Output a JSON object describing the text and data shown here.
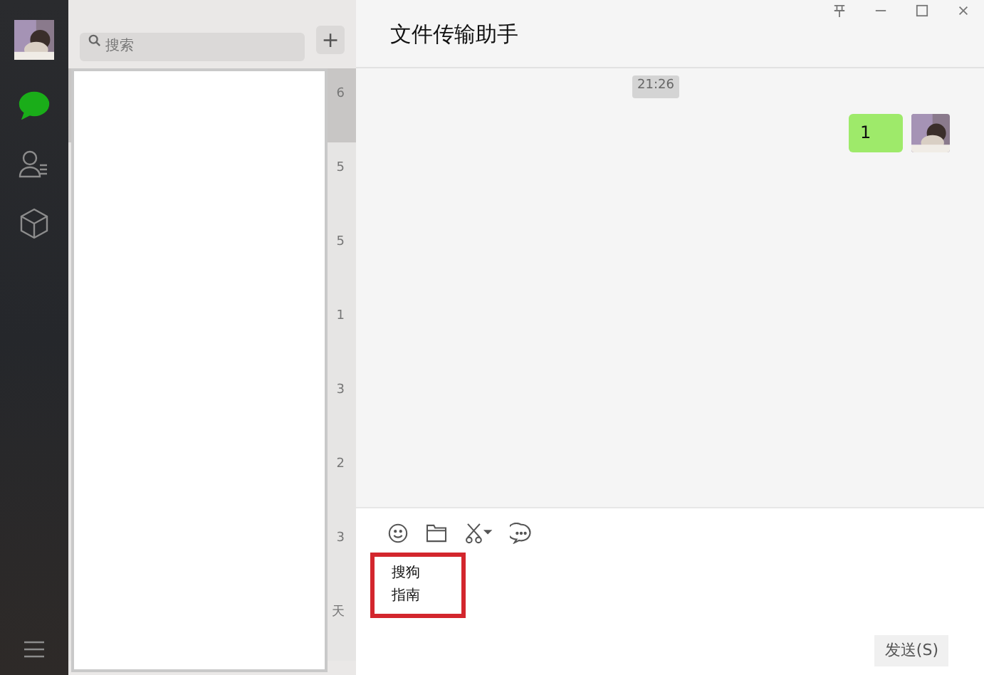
{
  "sidebar": {
    "items": [
      {
        "kind": "chat",
        "selected": true
      },
      {
        "kind": "contacts",
        "selected": false
      },
      {
        "kind": "apps",
        "selected": false
      }
    ]
  },
  "search": {
    "placeholder": "搜索",
    "add": "+"
  },
  "chat_list": [
    {
      "time": "6",
      "selected": true
    },
    {
      "time": "5",
      "selected": false
    },
    {
      "time": "5",
      "selected": false
    },
    {
      "time": "1",
      "selected": false
    },
    {
      "time": "3",
      "selected": false
    },
    {
      "time": "2",
      "selected": false
    },
    {
      "time": "3",
      "selected": false
    },
    {
      "time": "天",
      "selected": false
    }
  ],
  "window": {
    "title": "文件传输助手"
  },
  "messages": [
    {
      "kind": "time",
      "text": "21:26"
    },
    {
      "kind": "sent",
      "text": "1"
    }
  ],
  "input": {
    "lines": [
      "搜狗",
      "指南"
    ],
    "highlighted": true
  },
  "send_button": "发送(S)"
}
